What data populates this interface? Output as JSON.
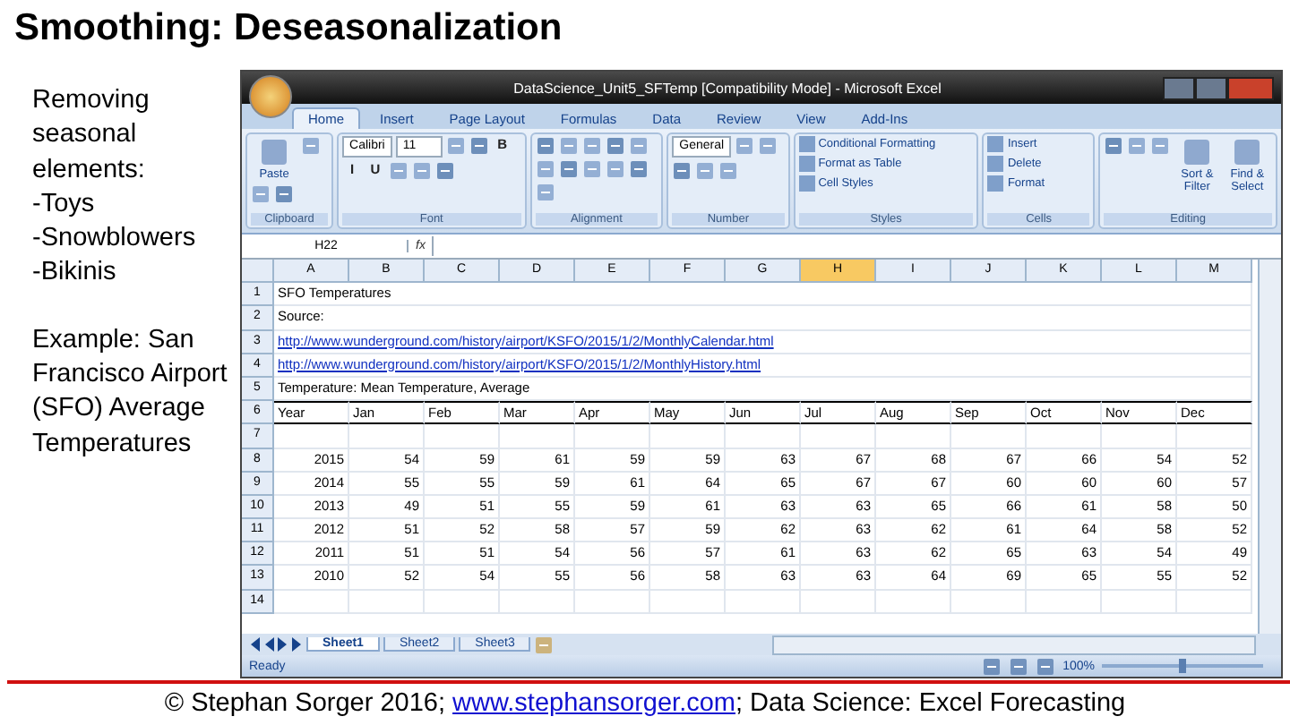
{
  "slide_title": "Smoothing: Deseasonalization",
  "left_blocks": [
    {
      "lines": [
        "Removing seasonal elements:",
        "-Toys",
        "-Snowblowers",
        "-Bikinis"
      ]
    },
    {
      "lines": [
        "Example: San Francisco Airport (SFO) Average Temperatures"
      ]
    }
  ],
  "excel": {
    "title": "DataScience_Unit5_SFTemp  [Compatibility Mode] - Microsoft Excel",
    "tabs": [
      {
        "label": "Home",
        "selected": true
      },
      {
        "label": "Insert",
        "selected": false
      },
      {
        "label": "Page Layout",
        "selected": false
      },
      {
        "label": "Formulas",
        "selected": false
      },
      {
        "label": "Data",
        "selected": false
      },
      {
        "label": "Review",
        "selected": false
      },
      {
        "label": "View",
        "selected": false
      },
      {
        "label": "Add-Ins",
        "selected": false
      }
    ],
    "ribbon": [
      {
        "label": "Clipboard",
        "items": [
          {
            "kind": "large",
            "text": "Paste"
          },
          {
            "kind": "icon"
          },
          {
            "kind": "icon"
          },
          {
            "kind": "icon"
          }
        ]
      },
      {
        "label": "Font",
        "items": [
          {
            "kind": "field",
            "text": "Calibri"
          },
          {
            "kind": "field",
            "text": "11"
          },
          {
            "kind": "icon"
          },
          {
            "kind": "icon"
          },
          {
            "kind": "glyph",
            "text": "B"
          },
          {
            "kind": "glyph",
            "text": "I"
          },
          {
            "kind": "glyph",
            "text": "U"
          },
          {
            "kind": "icon"
          },
          {
            "kind": "icon"
          },
          {
            "kind": "icon"
          }
        ]
      },
      {
        "label": "Alignment",
        "items": [
          {
            "kind": "icon"
          },
          {
            "kind": "icon"
          },
          {
            "kind": "icon"
          },
          {
            "kind": "icon"
          },
          {
            "kind": "icon"
          },
          {
            "kind": "icon"
          },
          {
            "kind": "icon"
          },
          {
            "kind": "icon"
          },
          {
            "kind": "icon"
          },
          {
            "kind": "icon"
          },
          {
            "kind": "icon"
          }
        ]
      },
      {
        "label": "Number",
        "items": [
          {
            "kind": "field",
            "text": "General"
          },
          {
            "kind": "icon"
          },
          {
            "kind": "icon"
          },
          {
            "kind": "icon"
          },
          {
            "kind": "icon"
          },
          {
            "kind": "icon"
          }
        ]
      },
      {
        "label": "Styles",
        "items": [
          {
            "kind": "small",
            "text": "Conditional Formatting"
          },
          {
            "kind": "small",
            "text": "Format as Table"
          },
          {
            "kind": "small",
            "text": "Cell Styles"
          }
        ]
      },
      {
        "label": "Cells",
        "items": [
          {
            "kind": "small",
            "text": "Insert"
          },
          {
            "kind": "small",
            "text": "Delete"
          },
          {
            "kind": "small",
            "text": "Format"
          }
        ]
      },
      {
        "label": "Editing",
        "items": [
          {
            "kind": "icon"
          },
          {
            "kind": "icon"
          },
          {
            "kind": "icon"
          },
          {
            "kind": "large",
            "text": "Sort & Filter"
          },
          {
            "kind": "large",
            "text": "Find & Select"
          }
        ]
      }
    ],
    "name_box": "H22",
    "fx": "fx",
    "columns": [
      {
        "label": "A",
        "selected": false
      },
      {
        "label": "B",
        "selected": false
      },
      {
        "label": "C",
        "selected": false
      },
      {
        "label": "D",
        "selected": false
      },
      {
        "label": "E",
        "selected": false
      },
      {
        "label": "F",
        "selected": false
      },
      {
        "label": "G",
        "selected": false
      },
      {
        "label": "H",
        "selected": true
      },
      {
        "label": "I",
        "selected": false
      },
      {
        "label": "J",
        "selected": false
      },
      {
        "label": "K",
        "selected": false
      },
      {
        "label": "L",
        "selected": false
      },
      {
        "label": "M",
        "selected": false
      }
    ],
    "rows": [
      {
        "number": "1",
        "kind": "text",
        "text": "SFO Temperatures"
      },
      {
        "number": "2",
        "kind": "text",
        "text": "Source:"
      },
      {
        "number": "3",
        "kind": "link",
        "text": "http://www.wunderground.com/history/airport/KSFO/2015/1/2/MonthlyCalendar.html"
      },
      {
        "number": "4",
        "kind": "link",
        "text": "http://www.wunderground.com/history/airport/KSFO/2015/1/2/MonthlyHistory.html"
      },
      {
        "number": "5",
        "kind": "text",
        "text": "Temperature: Mean Temperature, Average"
      },
      {
        "number": "6",
        "kind": "header",
        "cells": [
          "Year",
          "Jan",
          "Feb",
          "Mar",
          "Apr",
          "May",
          "Jun",
          "Jul",
          "Aug",
          "Sep",
          "Oct",
          "Nov",
          "Dec"
        ]
      },
      {
        "number": "7",
        "kind": "empty"
      },
      {
        "number": "8",
        "kind": "values",
        "cells": [
          "2015",
          "54",
          "59",
          "61",
          "59",
          "59",
          "63",
          "67",
          "68",
          "67",
          "66",
          "54",
          "52"
        ]
      },
      {
        "number": "9",
        "kind": "values",
        "cells": [
          "2014",
          "55",
          "55",
          "59",
          "61",
          "64",
          "65",
          "67",
          "67",
          "60",
          "60",
          "60",
          "57"
        ]
      },
      {
        "number": "10",
        "kind": "values",
        "cells": [
          "2013",
          "49",
          "51",
          "55",
          "59",
          "61",
          "63",
          "63",
          "65",
          "66",
          "61",
          "58",
          "50"
        ]
      },
      {
        "number": "11",
        "kind": "values",
        "cells": [
          "2012",
          "51",
          "52",
          "58",
          "57",
          "59",
          "62",
          "63",
          "62",
          "61",
          "64",
          "58",
          "52"
        ]
      },
      {
        "number": "12",
        "kind": "values",
        "cells": [
          "2011",
          "51",
          "51",
          "54",
          "56",
          "57",
          "61",
          "63",
          "62",
          "65",
          "63",
          "54",
          "49"
        ]
      },
      {
        "number": "13",
        "kind": "values",
        "cells": [
          "2010",
          "52",
          "54",
          "55",
          "56",
          "58",
          "63",
          "63",
          "64",
          "69",
          "65",
          "55",
          "52"
        ]
      },
      {
        "number": "14",
        "kind": "empty"
      }
    ],
    "sheet_tabs": [
      {
        "label": "Sheet1",
        "selected": true
      },
      {
        "label": "Sheet2",
        "selected": false
      },
      {
        "label": "Sheet3",
        "selected": false
      }
    ],
    "status": "Ready",
    "zoom": "100%",
    "zoom_slider": {
      "level": 0.5
    }
  },
  "footer": {
    "before": "© Stephan Sorger 2016; ",
    "link": "www.stephansorger.com",
    "after": "; Data Science: Excel Forecasting"
  }
}
